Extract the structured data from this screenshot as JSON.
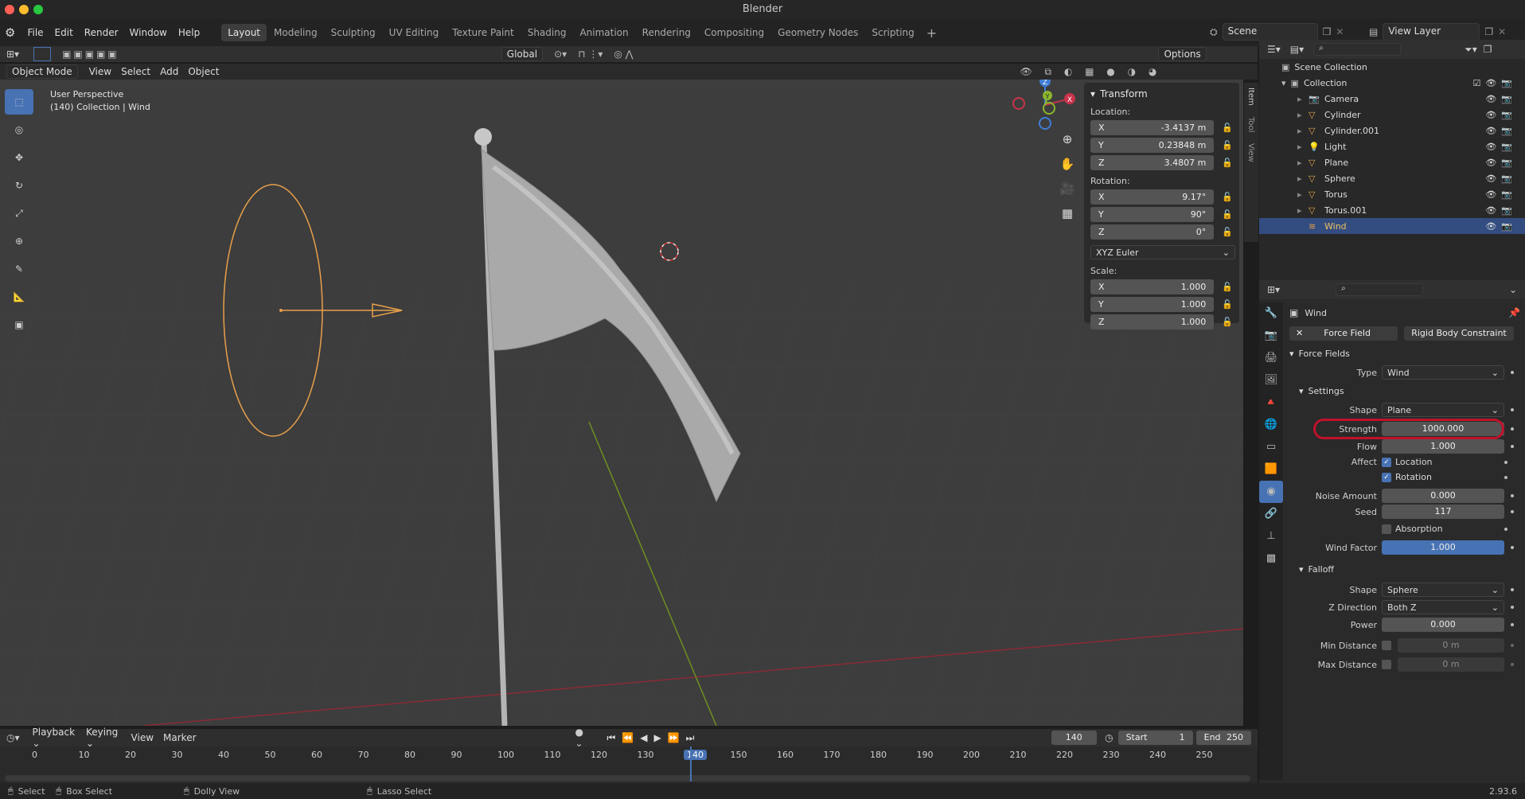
{
  "window": {
    "title": "Blender"
  },
  "menu": {
    "file": "File",
    "edit": "Edit",
    "render": "Render",
    "window": "Window",
    "help": "Help"
  },
  "workspaces": [
    "Layout",
    "Modeling",
    "Sculpting",
    "UV Editing",
    "Texture Paint",
    "Shading",
    "Animation",
    "Rendering",
    "Compositing",
    "Geometry Nodes",
    "Scripting"
  ],
  "active_workspace": "Layout",
  "scene": {
    "name": "Scene",
    "view_layer": "View Layer"
  },
  "viewport_header": {
    "mode": "Object Mode",
    "view": "View",
    "select": "Select",
    "add": "Add",
    "object": "Object",
    "orientation": "Global",
    "options": "Options"
  },
  "viewport": {
    "perspective": "User Perspective",
    "collection_info": "(140) Collection | Wind"
  },
  "gizmo": {
    "x": "X",
    "y": "Y",
    "z": "Z"
  },
  "npanel": {
    "tabs": [
      "Item",
      "Tool",
      "View"
    ],
    "section": "Transform",
    "location_label": "Location:",
    "location": [
      {
        "axis": "X",
        "value": "-3.4137 m"
      },
      {
        "axis": "Y",
        "value": "0.23848 m"
      },
      {
        "axis": "Z",
        "value": "3.4807 m"
      }
    ],
    "rotation_label": "Rotation:",
    "rotation": [
      {
        "axis": "X",
        "value": "9.17°"
      },
      {
        "axis": "Y",
        "value": "90°"
      },
      {
        "axis": "Z",
        "value": "0°"
      }
    ],
    "rotation_mode": "XYZ Euler",
    "scale_label": "Scale:",
    "scale": [
      {
        "axis": "X",
        "value": "1.000"
      },
      {
        "axis": "Y",
        "value": "1.000"
      },
      {
        "axis": "Z",
        "value": "1.000"
      }
    ]
  },
  "outliner": {
    "scene_collection": "Scene Collection",
    "collection": "Collection",
    "items": [
      {
        "name": "Camera",
        "icon": "camera-icon"
      },
      {
        "name": "Cylinder",
        "icon": "mesh-icon"
      },
      {
        "name": "Cylinder.001",
        "icon": "mesh-icon"
      },
      {
        "name": "Light",
        "icon": "light-icon"
      },
      {
        "name": "Plane",
        "icon": "mesh-icon"
      },
      {
        "name": "Sphere",
        "icon": "mesh-icon"
      },
      {
        "name": "Torus",
        "icon": "mesh-icon"
      },
      {
        "name": "Torus.001",
        "icon": "mesh-icon"
      },
      {
        "name": "Wind",
        "icon": "wind-icon",
        "selected": true
      }
    ]
  },
  "properties": {
    "object_name": "Wind",
    "force_field_btn": "Force Field",
    "rigid_body_btn": "Rigid Body Constraint",
    "force_fields_section": "Force Fields",
    "type_label": "Type",
    "type_value": "Wind",
    "settings_section": "Settings",
    "shape_label": "Shape",
    "shape_value": "Plane",
    "strength_label": "Strength",
    "strength_value": "1000.000",
    "flow_label": "Flow",
    "flow_value": "1.000",
    "affect_label": "Affect",
    "affect_location": "Location",
    "affect_rotation": "Rotation",
    "noise_label": "Noise Amount",
    "noise_value": "0.000",
    "seed_label": "Seed",
    "seed_value": "117",
    "absorption_label": "Absorption",
    "wind_factor_label": "Wind Factor",
    "wind_factor_value": "1.000",
    "falloff_section": "Falloff",
    "falloff_shape_label": "Shape",
    "falloff_shape_value": "Sphere",
    "zdir_label": "Z Direction",
    "zdir_value": "Both Z",
    "power_label": "Power",
    "power_value": "0.000",
    "min_dist_label": "Min Distance",
    "min_dist_value": "0 m",
    "max_dist_label": "Max Distance",
    "max_dist_value": "0 m"
  },
  "timeline": {
    "playback": "Playback",
    "keying": "Keying",
    "view": "View",
    "marker": "Marker",
    "current_frame": "140",
    "start_label": "Start",
    "start_value": "1",
    "end_label": "End",
    "end_value": "250",
    "ticks": [
      "0",
      "10",
      "20",
      "30",
      "40",
      "50",
      "60",
      "70",
      "80",
      "90",
      "100",
      "110",
      "120",
      "130",
      "140",
      "150",
      "160",
      "170",
      "180",
      "190",
      "200",
      "210",
      "220",
      "230",
      "240",
      "250"
    ]
  },
  "statusbar": {
    "select": "Select",
    "box_select": "Box Select",
    "dolly_view": "Dolly View",
    "lasso_select": "Lasso Select",
    "version": "2.93.6"
  },
  "colors": {
    "accent": "#4772b3",
    "highlight_ring": "#c0122b",
    "selection_orange": "#e8a04a",
    "x_axis": "#c8334a",
    "y_axis": "#8bb62d",
    "z_axis": "#3f7cd6"
  }
}
